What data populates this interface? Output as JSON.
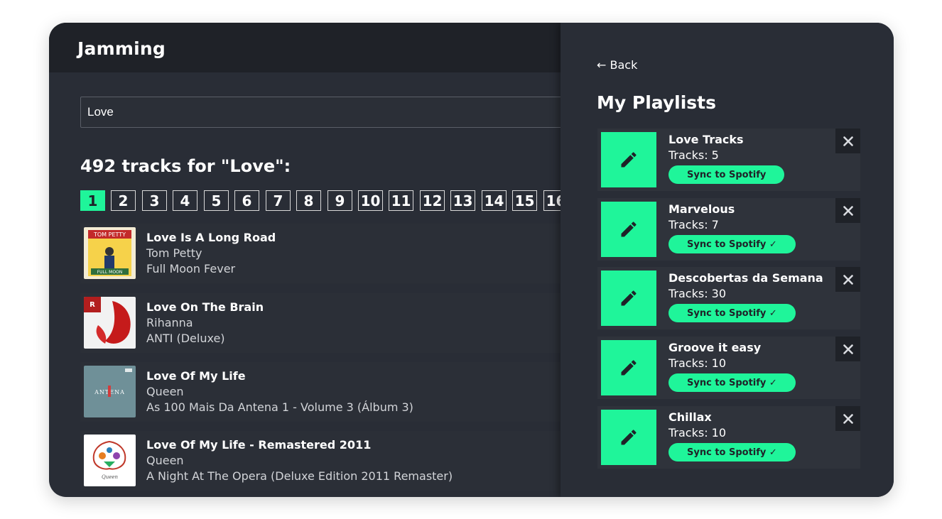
{
  "app": {
    "title": "Jamming"
  },
  "search": {
    "value": "Love"
  },
  "results": {
    "heading": "492 tracks for \"Love\":"
  },
  "pagination": {
    "pages": [
      "1",
      "2",
      "3",
      "4",
      "5",
      "6",
      "7",
      "8",
      "9",
      "10",
      "11",
      "12",
      "13",
      "14",
      "15",
      "16"
    ],
    "active": "1"
  },
  "tracks": [
    {
      "title": "Love Is A Long Road",
      "artist": "Tom Petty",
      "album": "Full Moon Fever",
      "cover_label": "TOM PETTY",
      "cover_sub": "FULL MOON"
    },
    {
      "title": "Love On The Brain",
      "artist": "Rihanna",
      "album": "ANTI (Deluxe)",
      "cover_label": "R",
      "cover_sub": ""
    },
    {
      "title": "Love Of My Life",
      "artist": "Queen",
      "album": "As 100 Mais Da Antena 1 - Volume 3 (Álbum 3)",
      "cover_label": "ANTENA",
      "cover_sub": ""
    },
    {
      "title": "Love Of My Life - Remastered 2011",
      "artist": "Queen",
      "album": "A Night At The Opera (Deluxe Edition 2011 Remaster)",
      "cover_label": "Queen",
      "cover_sub": ""
    }
  ],
  "playlists_panel": {
    "back_label": "← Back",
    "title": "My Playlists",
    "remove_icon": "✕",
    "playlists": [
      {
        "name": "Love Tracks",
        "tracks": "Tracks: 5",
        "sync_label": "Sync to Spotify"
      },
      {
        "name": "Marvelous",
        "tracks": "Tracks: 7",
        "sync_label": "Sync to Spotify ✓"
      },
      {
        "name": "Descobertas da Semana",
        "tracks": "Tracks: 30",
        "sync_label": "Sync to Spotify ✓"
      },
      {
        "name": "Groove it easy",
        "tracks": "Tracks: 10",
        "sync_label": "Sync to Spotify ✓"
      },
      {
        "name": "Chillax",
        "tracks": "Tracks: 10",
        "sync_label": "Sync to Spotify ✓"
      }
    ]
  },
  "colors": {
    "accent": "#1ff59a",
    "background": "#292d36",
    "header": "#1f2228"
  },
  "icons": {
    "edit": "pencil-icon",
    "remove": "close-icon",
    "back": "arrow-left-icon"
  }
}
